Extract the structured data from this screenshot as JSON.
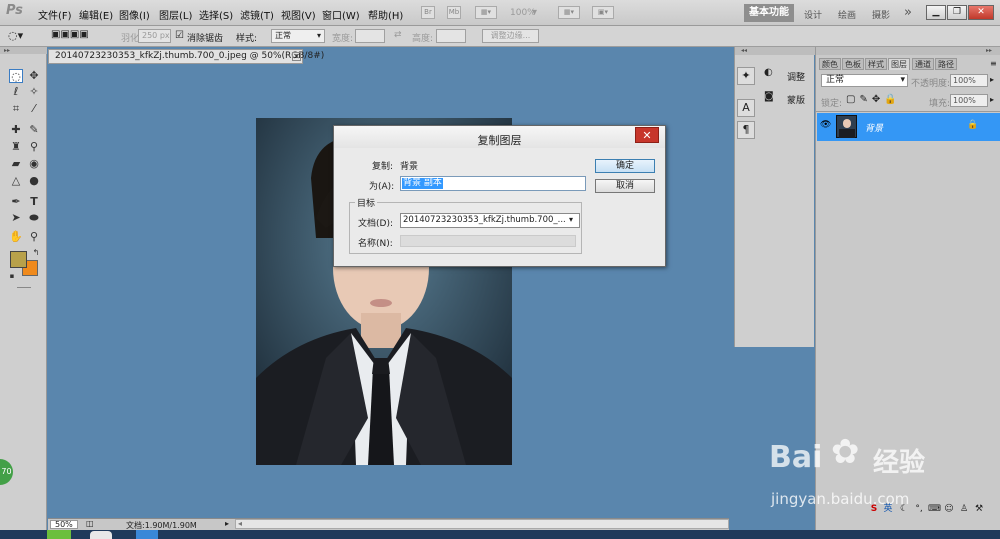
{
  "app": {
    "logo": "Ps"
  },
  "menus": [
    "文件(F)",
    "编辑(E)",
    "图像(I)",
    "图层(L)",
    "选择(S)",
    "滤镜(T)",
    "视图(V)",
    "窗口(W)",
    "帮助(H)"
  ],
  "menubar": {
    "zoom": "100%",
    "workspaces": [
      "基本功能",
      "设计",
      "绘画",
      "摄影"
    ],
    "more": "»"
  },
  "options": {
    "feather_label": "羽化:",
    "feather_value": "250 px",
    "antialias_label": "消除锯齿",
    "style_label": "样式:",
    "style_value": "正常",
    "width_label": "宽度:",
    "height_label": "高度:",
    "refine_edge": "调整边缘..."
  },
  "document": {
    "tab_title": "20140723230353_kfkZj.thumb.700_0.jpeg @ 50%(RGB/8#)",
    "zoom": "50%",
    "doc_size": "文档:1.90M/1.90M"
  },
  "midpanel": {
    "adjust": "调整",
    "masks": "蒙版"
  },
  "layers_panel": {
    "tabs": [
      "颜色",
      "色板",
      "样式",
      "图层",
      "通道",
      "路径"
    ],
    "blend_mode": "正常",
    "opacity_label": "不透明度:",
    "opacity_value": "100%",
    "lock_label": "锁定:",
    "fill_label": "填充:",
    "fill_value": "100%",
    "layer_name": "背景"
  },
  "dialog": {
    "title": "复制图层",
    "duplicate_label": "复制:",
    "duplicate_value": "背景",
    "as_label": "为(A):",
    "as_value": "背景 副本",
    "ok": "确定",
    "cancel": "取消",
    "destination_label": "目标",
    "document_label": "文档(D):",
    "document_value": "20140723230353_kfkZj.thumb.700_...",
    "name_label": "名称(N):"
  },
  "watermark": {
    "brand": "Bai",
    "brand2": "经验",
    "url": "jingyan.baidu.com"
  },
  "badge": "70",
  "colors": {
    "accent": "#3497f5",
    "canvas": "#5a86ad",
    "fg_swatch": "#b8a14a",
    "bg_swatch": "#f08a1c"
  }
}
